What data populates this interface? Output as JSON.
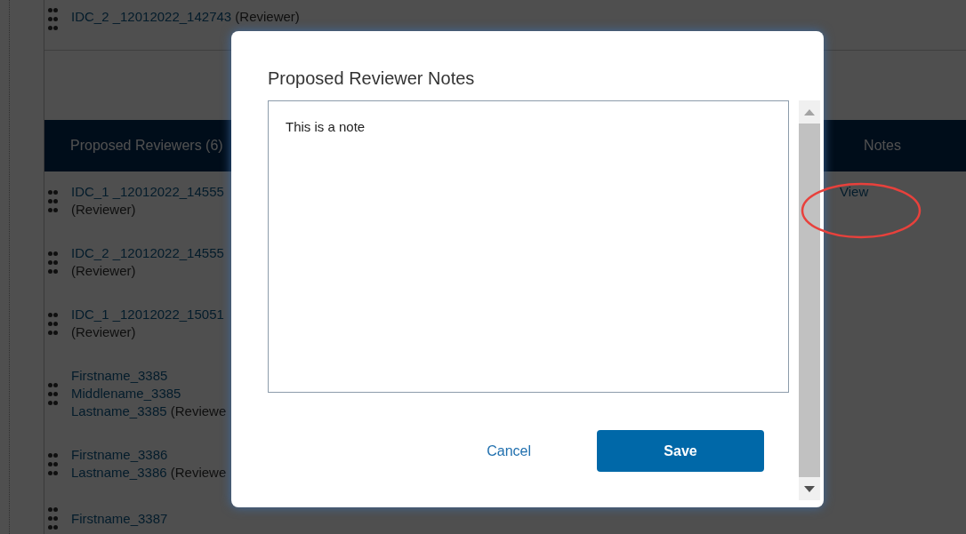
{
  "background_page": {
    "top_row": {
      "name": "IDC_2 _12012022_142743",
      "role": "(Reviewer)"
    },
    "table": {
      "columns": [
        "Proposed Reviewers (6)",
        "Notes"
      ],
      "rows": [
        {
          "lines": [
            [
              {
                "kind": "name",
                "text": "IDC_1 _12012022_14555"
              }
            ],
            [
              {
                "kind": "role",
                "text": "(Reviewer)"
              }
            ]
          ],
          "notes_link": "View"
        },
        {
          "lines": [
            [
              {
                "kind": "name",
                "text": "IDC_2 _12012022_14555"
              }
            ],
            [
              {
                "kind": "role",
                "text": "(Reviewer)"
              }
            ]
          ]
        },
        {
          "lines": [
            [
              {
                "kind": "name",
                "text": "IDC_1 _12012022_15051"
              }
            ],
            [
              {
                "kind": "role",
                "text": "(Reviewer)"
              }
            ]
          ]
        },
        {
          "lines": [
            [
              {
                "kind": "name",
                "text": "Firstname_3385"
              }
            ],
            [
              {
                "kind": "name",
                "text": "Middlename_3385"
              }
            ],
            [
              {
                "kind": "name",
                "text": "Lastname_3385"
              },
              {
                "kind": "role",
                "text": "(Reviewe"
              }
            ]
          ]
        },
        {
          "lines": [
            [
              {
                "kind": "name",
                "text": "Firstname_3386"
              }
            ],
            [
              {
                "kind": "name",
                "text": "Lastname_3386"
              },
              {
                "kind": "role",
                "text": "(Reviewe"
              }
            ]
          ]
        },
        {
          "lines": [
            [
              {
                "kind": "name",
                "text": "Firstname_3387"
              }
            ]
          ]
        }
      ]
    }
  },
  "modal": {
    "title": "Proposed Reviewer Notes",
    "notes_field": {
      "value": "This is a note"
    },
    "buttons": [
      {
        "label": "Cancel",
        "kind": "link"
      },
      {
        "label": "Save",
        "kind": "primary"
      }
    ]
  }
}
